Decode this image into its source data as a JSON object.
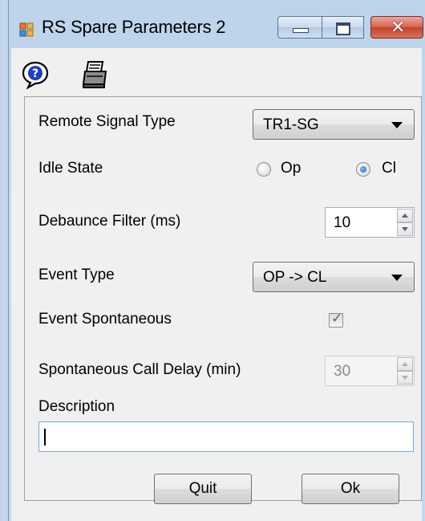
{
  "window": {
    "title": "RS Spare Parameters 2",
    "controls": {
      "minimize_icon": "minimize-icon",
      "maximize_icon": "maximize-icon",
      "close_icon": "close-icon",
      "close_glyph": "✕"
    }
  },
  "toolbar": {
    "help_icon": "help-icon",
    "print_icon": "printer-icon"
  },
  "form": {
    "remote_signal_type": {
      "label": "Remote Signal Type",
      "value": "TR1-SG"
    },
    "idle_state": {
      "label": "Idle State",
      "options": [
        {
          "label": "Op",
          "checked": false
        },
        {
          "label": "Cl",
          "checked": true
        }
      ]
    },
    "debounce_filter": {
      "label": "Debaunce Filter (ms)",
      "value": "10"
    },
    "event_type": {
      "label": "Event Type",
      "value": "OP -> CL"
    },
    "event_spontaneous": {
      "label": "Event Spontaneous",
      "checked": true
    },
    "spontaneous_call_delay": {
      "label": "Spontaneous Call Delay (min)",
      "value": "30",
      "enabled": false
    },
    "description": {
      "label": "Description",
      "value": ""
    }
  },
  "buttons": {
    "quit": "Quit",
    "ok": "Ok"
  },
  "colors": {
    "frame": "#c5d8ec",
    "close_button": "#c4412b",
    "client": "#f0f0f0",
    "focus_border": "#7aa8d8"
  }
}
